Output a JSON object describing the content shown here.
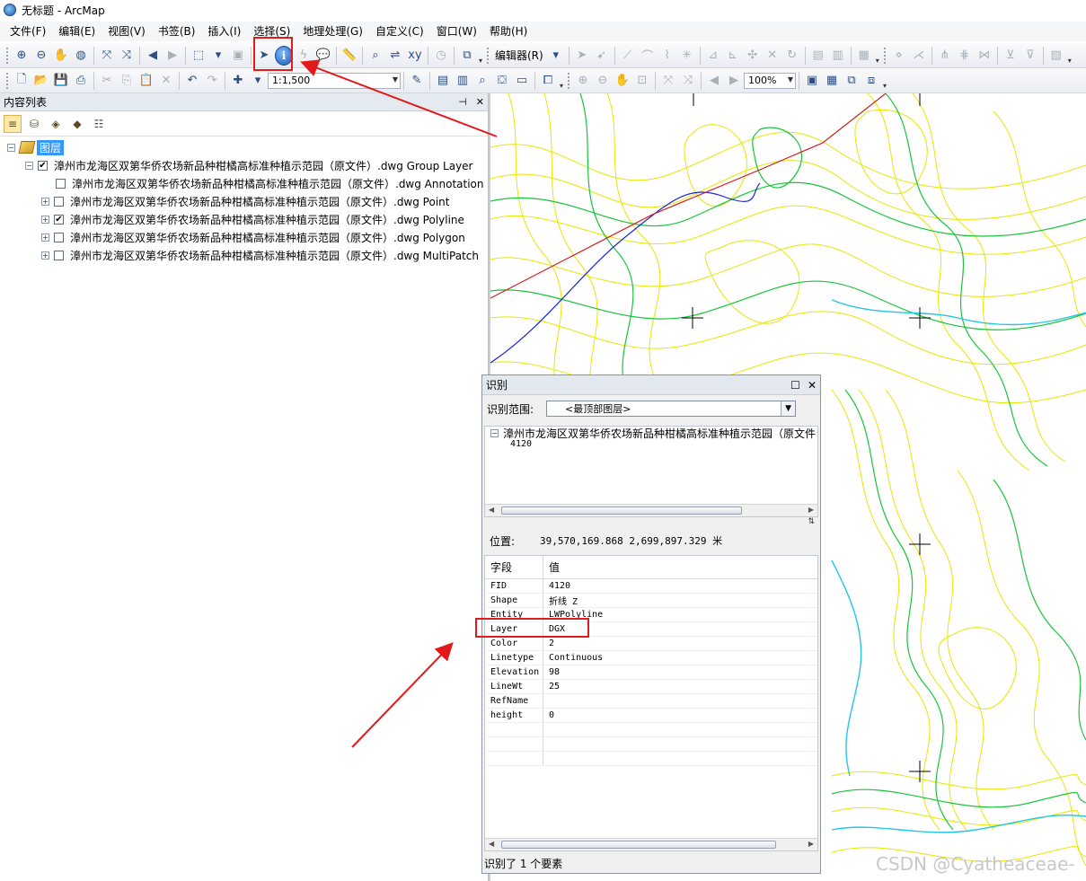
{
  "window": {
    "title": "无标题 - ArcMap"
  },
  "menu": [
    "文件(F)",
    "编辑(E)",
    "视图(V)",
    "书签(B)",
    "插入(I)",
    "选择(S)",
    "地理处理(G)",
    "自定义(C)",
    "窗口(W)",
    "帮助(H)"
  ],
  "toolbar": {
    "editor_label": "编辑器(R)",
    "scale": "1:1,500",
    "zoom_percent": "100%"
  },
  "toc": {
    "title": "内容列表",
    "root_label": "图层",
    "group_layer": {
      "label": "漳州市龙海区双第华侨农场新品种柑橘高标准种植示范园（原文件）.dwg Group Layer",
      "checked": true
    },
    "sublayers": [
      {
        "label": "漳州市龙海区双第华侨农场新品种柑橘高标准种植示范园（原文件）.dwg Annotation",
        "checked": false,
        "expandable": false
      },
      {
        "label": "漳州市龙海区双第华侨农场新品种柑橘高标准种植示范园（原文件）.dwg Point",
        "checked": false,
        "expandable": true
      },
      {
        "label": "漳州市龙海区双第华侨农场新品种柑橘高标准种植示范园（原文件）.dwg Polyline",
        "checked": true,
        "expandable": true
      },
      {
        "label": "漳州市龙海区双第华侨农场新品种柑橘高标准种植示范园（原文件）.dwg Polygon",
        "checked": false,
        "expandable": true
      },
      {
        "label": "漳州市龙海区双第华侨农场新品种柑橘高标准种植示范园（原文件）.dwg MultiPatch",
        "checked": false,
        "expandable": true
      }
    ]
  },
  "identify": {
    "title": "识别",
    "range_label": "识别范围:",
    "range_value": "<最顶部图层>",
    "tree_layer": "漳州市龙海区双第华侨农场新品种柑橘高标准种植示范园（原文件",
    "tree_feature": "4120",
    "location_label": "位置:",
    "location_value": "39,570,169.868  2,699,897.329 米",
    "col_field": "字段",
    "col_value": "值",
    "rows": [
      {
        "field": "FID",
        "value": "4120"
      },
      {
        "field": "Shape",
        "value": "折线 Z"
      },
      {
        "field": "Entity",
        "value": "LWPolyline"
      },
      {
        "field": "Layer",
        "value": "DGX"
      },
      {
        "field": "Color",
        "value": "2"
      },
      {
        "field": "Linetype",
        "value": "Continuous"
      },
      {
        "field": "Elevation",
        "value": "98"
      },
      {
        "field": "LineWt",
        "value": "25"
      },
      {
        "field": "RefName",
        "value": ""
      },
      {
        "field": "height",
        "value": "0"
      }
    ],
    "status": "识别了 1 个要素"
  },
  "watermark": "CSDN @Cyatheaceae-",
  "colors": {
    "annotation_red": "#e21a1a",
    "contour_yellow": "#e8e600",
    "contour_green": "#19c43a",
    "river_cyan": "#22c6e6"
  }
}
